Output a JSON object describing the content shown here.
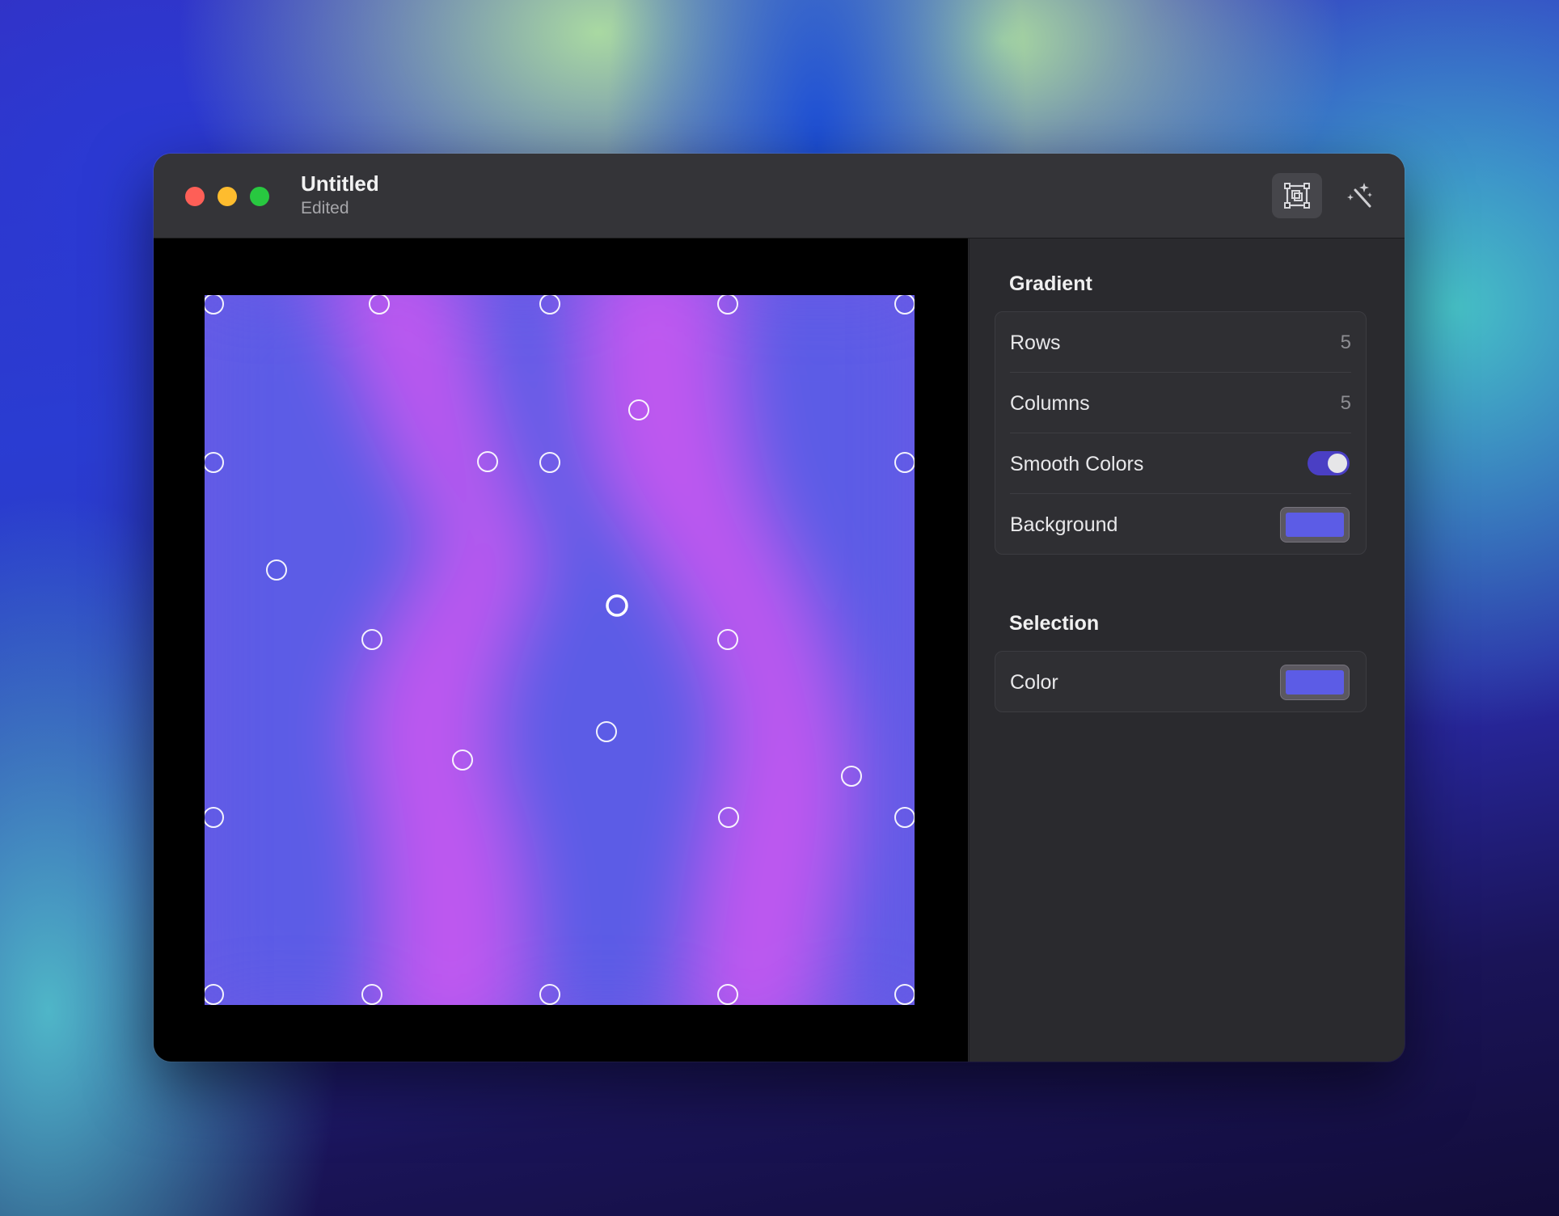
{
  "window": {
    "title": "Untitled",
    "subtitle": "Edited"
  },
  "toolbar": {
    "buttons": [
      {
        "icon": "frame-select-icon",
        "active": true
      },
      {
        "icon": "magic-wand-icon",
        "active": false
      }
    ]
  },
  "gradient_section": {
    "title": "Gradient",
    "rows_label": "Rows",
    "rows_value": "5",
    "columns_label": "Columns",
    "columns_value": "5",
    "smooth_label": "Smooth Colors",
    "smooth_on": true,
    "background_label": "Background",
    "background_color": "#5c5ce6"
  },
  "selection_section": {
    "title": "Selection",
    "color_label": "Color",
    "color_value": "#5c5ce6"
  },
  "mesh": {
    "rows": 5,
    "columns": 5,
    "colors": {
      "blue": "#5c5ce6",
      "purple": "#c058f0"
    },
    "selected_point": "r2c2"
  }
}
